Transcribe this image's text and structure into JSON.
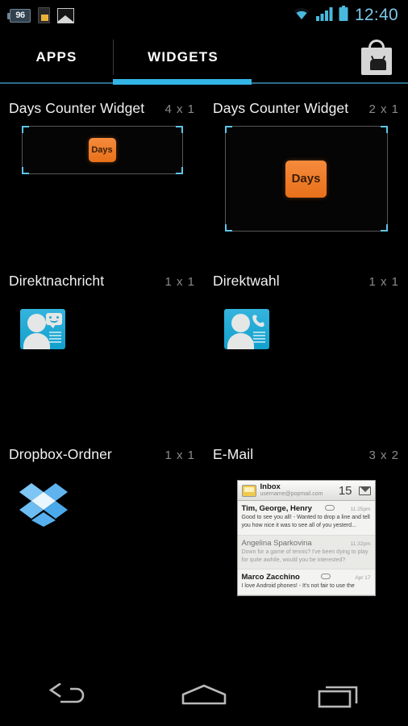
{
  "statusbar": {
    "battery_percent": "96",
    "time": "12:40",
    "icons": [
      "battery-percent-badge",
      "sim-card-icon",
      "picture-icon",
      "wifi-icon",
      "signal-icon",
      "battery-icon"
    ]
  },
  "header": {
    "tabs": [
      {
        "label": "APPS",
        "selected": false
      },
      {
        "label": "WIDGETS",
        "selected": true
      }
    ],
    "shop_icon": "play-store-bag-icon"
  },
  "widgets": [
    {
      "name": "Days Counter Widget",
      "size": "4 x 1",
      "preview": "framed",
      "tile_label": "Days"
    },
    {
      "name": "Days Counter Widget",
      "size": "2 x 1",
      "preview": "framed",
      "tile_label": "Days"
    },
    {
      "name": "Direktnachricht",
      "size": "1 x 1",
      "preview": "contact-message-icon"
    },
    {
      "name": "Direktwahl",
      "size": "1 x 1",
      "preview": "contact-call-icon"
    },
    {
      "name": "Dropbox-Ordner",
      "size": "1 x 1",
      "preview": "dropbox-icon"
    },
    {
      "name": "E-Mail",
      "size": "3 x 2",
      "preview": "mail-card"
    }
  ],
  "mail_preview": {
    "folder": "Inbox",
    "account": "username@popmail.com",
    "unread_count": "15",
    "messages": [
      {
        "from": "Tim, George, Henry",
        "time": "11:25pm",
        "snippet": "Good to see you all! - Wanted to drop a line and tell you how nice it was to see all of you yesterd...",
        "read": false
      },
      {
        "from": "Angelina Sparkovina",
        "time": "11:32pm",
        "snippet": "Down for a game of tennis? I've been dying to play for quite awhile, would you be interested?",
        "read": true
      },
      {
        "from": "Marco Zacchino",
        "time": "Apr 17",
        "snippet": "I love Android phones! -  It's not fair to use the",
        "read": false
      }
    ]
  },
  "navbar": {
    "buttons": [
      {
        "name": "back",
        "icon": "back-arrow-icon"
      },
      {
        "name": "home",
        "icon": "home-icon"
      },
      {
        "name": "recents",
        "icon": "recent-apps-icon"
      }
    ]
  },
  "colors": {
    "accent": "#33b5e5",
    "clock": "#7cc7e8",
    "widget_tile": "#f0802a",
    "background": "#000000",
    "size_label": "#8a8a8a"
  }
}
